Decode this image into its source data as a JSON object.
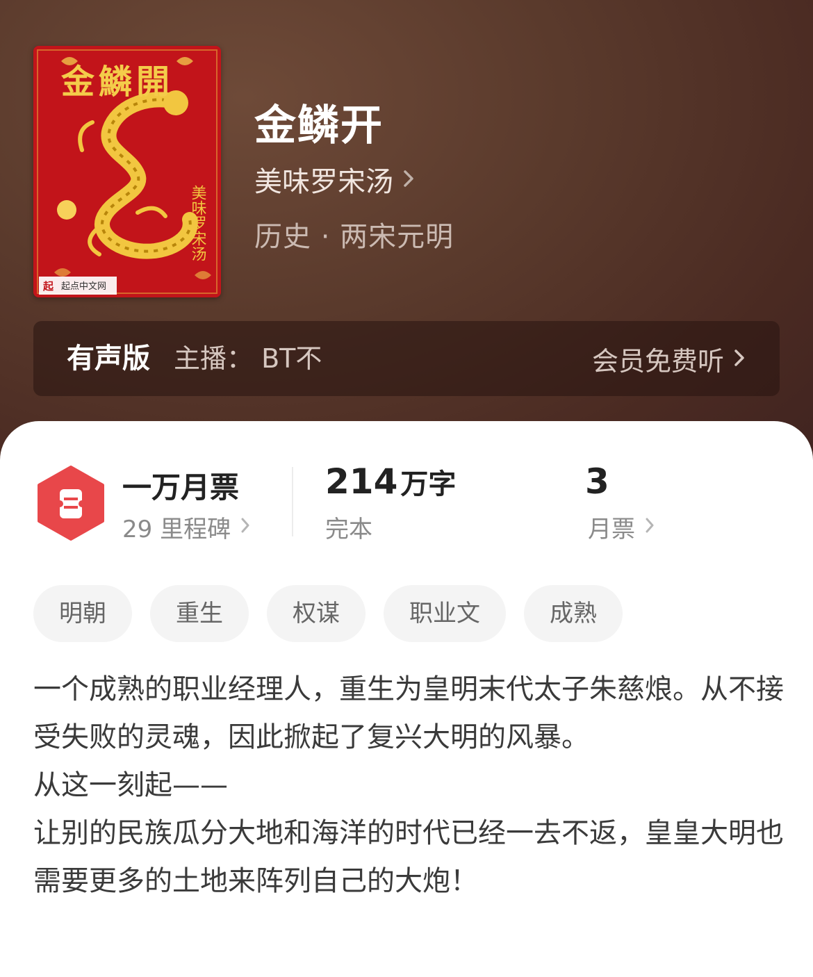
{
  "book": {
    "title": "金鳞开",
    "author": "美味罗宋汤",
    "genre": "历史 · 两宋元明",
    "cover_title": "金鱗開",
    "cover_publisher": "起点中文网"
  },
  "audio": {
    "label": "有声版",
    "host": "主播：  BT不",
    "free_listen": "会员免费听"
  },
  "stats": {
    "tickets_title": "一万月票",
    "milestones": "29 里程碑",
    "words_number": "214",
    "words_unit": "万字",
    "status": "完本",
    "monthly_count": "3",
    "monthly_label": "月票"
  },
  "tags": [
    "明朝",
    "重生",
    "权谋",
    "职业文",
    "成熟"
  ],
  "synopsis": [
    "一个成熟的职业经理人，重生为皇明末代太子朱慈烺。从不接受失败的灵魂，因此掀起了复兴大明的风暴。",
    "从这一刻起——",
    "让别的民族瓜分大地和海洋的时代已经一去不返，皇皇大明也需要更多的土地来阵列自己的大炮！"
  ],
  "colors": {
    "header_bg": "#5a3a2c",
    "badge_red": "#e8474a",
    "cover_red": "#c2141a",
    "gold": "#e7b733"
  },
  "icons": {
    "chevron": "chevron-right-icon",
    "badge": "monthly-ticket-icon"
  }
}
